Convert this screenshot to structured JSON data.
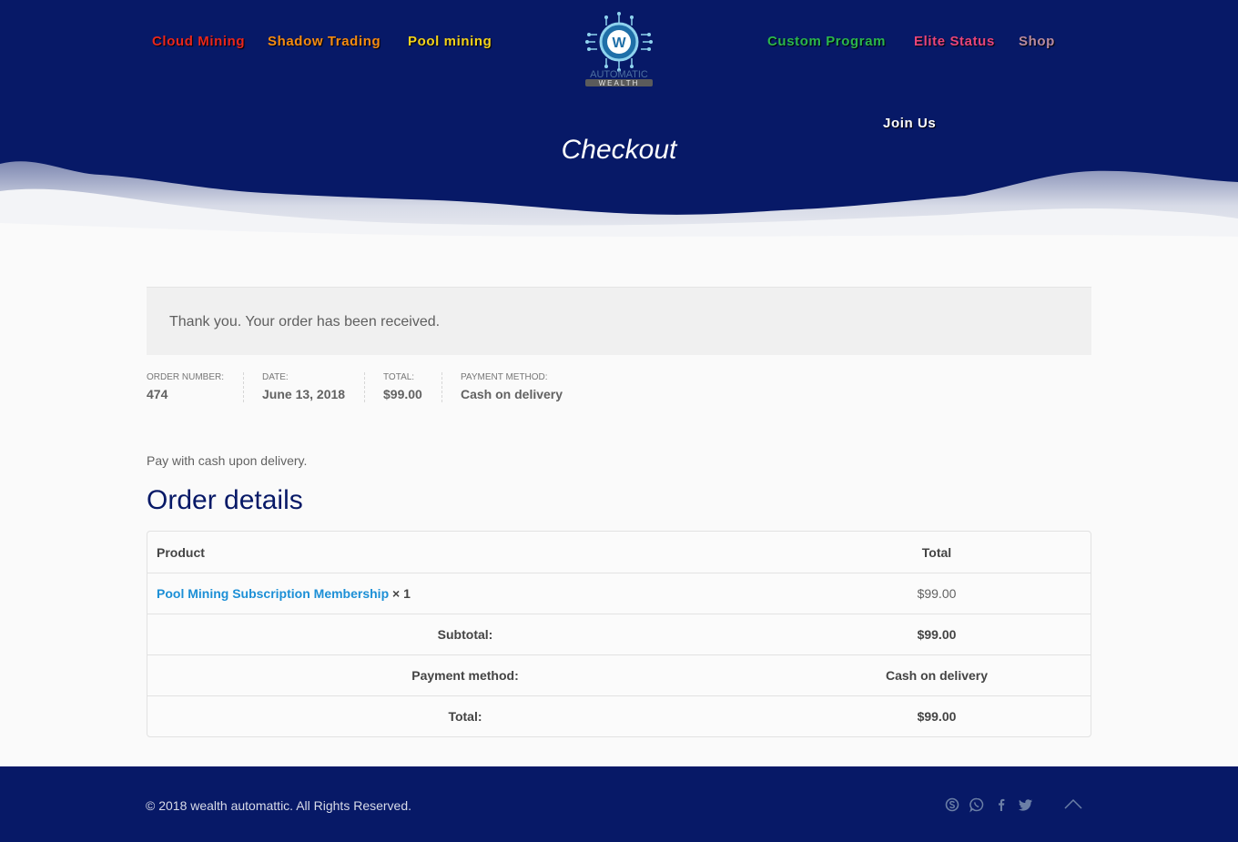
{
  "nav": {
    "left": [
      {
        "label": "Cloud Mining",
        "color": "#e8261c"
      },
      {
        "label": "Shadow Trading",
        "color": "#f58b12"
      },
      {
        "label": "Pool mining",
        "color": "#f3d21a"
      }
    ],
    "right": [
      {
        "label": "Custom Program",
        "color": "#2bb64c"
      },
      {
        "label": "Elite Status",
        "color": "#e8457a"
      },
      {
        "label": "Shop",
        "color": "#b78a9e"
      }
    ],
    "join": "Join Us"
  },
  "logo": {
    "line1": "AUTOMATIC",
    "line2": "WEALTH",
    "mark": "W"
  },
  "page_title": "Checkout",
  "notice": "Thank you. Your order has been received.",
  "overview": [
    {
      "label": "Order number:",
      "value": "474"
    },
    {
      "label": "Date:",
      "value": "June 13, 2018"
    },
    {
      "label": "Total:",
      "value": "$99.00"
    },
    {
      "label": "Payment method:",
      "value": "Cash on delivery"
    }
  ],
  "payment_note": "Pay with cash upon delivery.",
  "order_details": {
    "heading": "Order details",
    "headers": {
      "product": "Product",
      "total": "Total"
    },
    "item": {
      "name": "Pool Mining Subscription Membership",
      "qty": "× 1",
      "total": "$99.00"
    },
    "subtotal": {
      "label": "Subtotal:",
      "value": "$99.00"
    },
    "payment": {
      "label": "Payment method:",
      "value": "Cash on delivery"
    },
    "total": {
      "label": "Total:",
      "value": "$99.00"
    }
  },
  "footer": {
    "copyright": "© 2018 wealth automattic. All Rights Reserved.",
    "social_icons": [
      "skype-icon",
      "whatsapp-icon",
      "facebook-icon",
      "twitter-icon"
    ],
    "back_to_top": "chevron-up-icon"
  },
  "colors": {
    "header_bg": "#071967",
    "link": "#1c8fd6",
    "heading": "#071967"
  }
}
